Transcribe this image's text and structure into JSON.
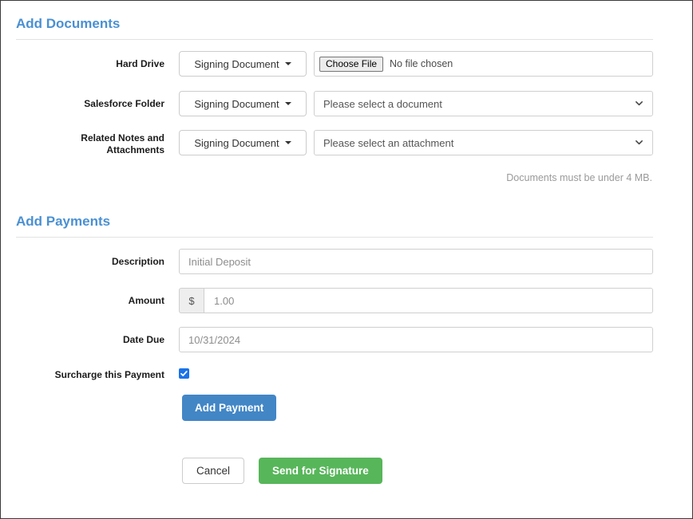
{
  "documents_section": {
    "title": "Add Documents",
    "rows": [
      {
        "label": "Hard Drive",
        "doc_type": "Signing Document",
        "control": "file",
        "choose_label": "Choose File",
        "file_status": "No file chosen"
      },
      {
        "label": "Salesforce Folder",
        "doc_type": "Signing Document",
        "control": "select",
        "select_value": "Please select a document"
      },
      {
        "label": "Related Notes and Attachments",
        "label_line1": "Related Notes and",
        "label_line2": "Attachments",
        "doc_type": "Signing Document",
        "control": "select",
        "select_value": "Please select an attachment"
      }
    ],
    "helper_note": "Documents must be under 4 MB."
  },
  "payments_section": {
    "title": "Add Payments",
    "description": {
      "label": "Description",
      "value": "Initial Deposit",
      "placeholder": "Initial Deposit"
    },
    "amount": {
      "label": "Amount",
      "currency_symbol": "$",
      "value": "1.00",
      "placeholder": "1.00"
    },
    "date_due": {
      "label": "Date Due",
      "value": "10/31/2024",
      "placeholder": "10/31/2024"
    },
    "surcharge": {
      "label": "Surcharge this Payment",
      "checked": true
    },
    "add_payment_label": "Add Payment"
  },
  "footer": {
    "cancel_label": "Cancel",
    "submit_label": "Send for Signature"
  },
  "colors": {
    "heading": "#4a90d2",
    "primary": "#4286c6",
    "success": "#57b65a",
    "checkbox": "#1a73e8",
    "helper_text": "#9a9a9a",
    "border": "#cfcfcf"
  }
}
